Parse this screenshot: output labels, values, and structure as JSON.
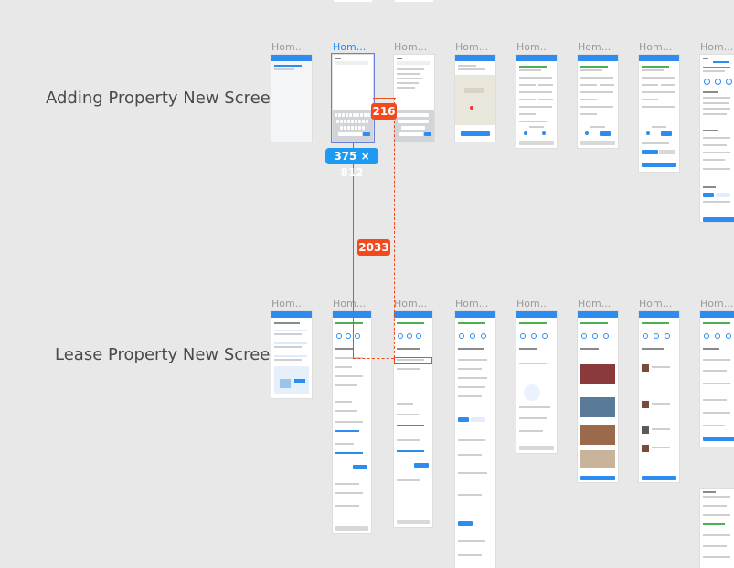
{
  "rows": [
    {
      "title": "Adding Property New Screens",
      "frames": [
        "Hom...",
        "Hom...",
        "Hom...",
        "Hom...",
        "Hom...",
        "Hom...",
        "Hom...",
        "Hom..."
      ]
    },
    {
      "title": "Lease Property New Screens",
      "frames": [
        "Hom...",
        "Hom...",
        "Hom...",
        "Hom...",
        "Hom...",
        "Hom...",
        "Hom...",
        "Hom..."
      ]
    }
  ],
  "measurements": {
    "frame_size": "375 × 812",
    "horizontal_distance": "216",
    "vertical_distance": "2033"
  },
  "colors": {
    "selection": "#1a8cff",
    "redline": "#f24a1d",
    "canvas": "#e8e8e8",
    "app_primary": "#2d8cf0"
  }
}
